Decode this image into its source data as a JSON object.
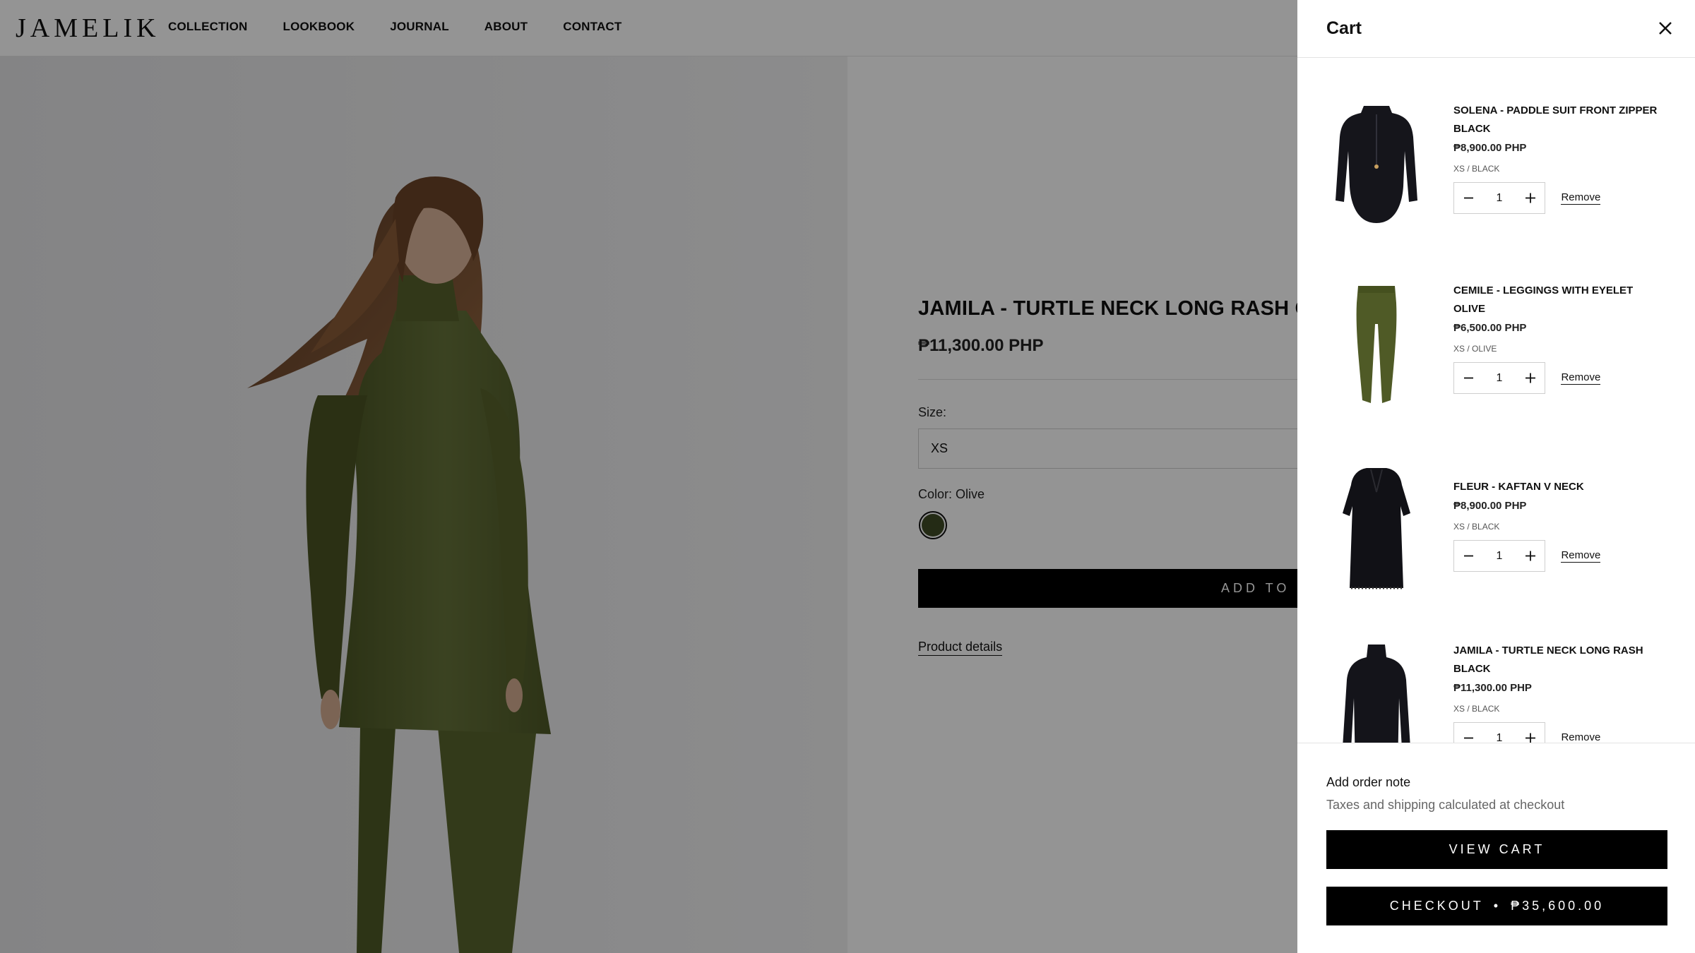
{
  "brand": {
    "logo": "JAMELIK"
  },
  "nav": {
    "items": [
      "COLLECTION",
      "LOOKBOOK",
      "JOURNAL",
      "ABOUT",
      "CONTACT"
    ]
  },
  "product": {
    "title": "JAMILA - TURTLE NECK LONG RASH OLIVE",
    "price": "₱11,300.00 PHP",
    "size_label": "Size:",
    "size_value": "XS",
    "color_label": "Color: Olive",
    "color_swatch": "#3f4a25",
    "add_to_cart": "ADD TO CART",
    "details_link": "Product details"
  },
  "cart": {
    "title": "Cart",
    "items": [
      {
        "title": "SOLENA - PADDLE SUIT FRONT ZIPPER BLACK",
        "price": "₱8,900.00 PHP",
        "variant": "XS / BLACK",
        "qty": "1",
        "remove": "Remove",
        "image": "black-paddle-suit"
      },
      {
        "title": "CEMILE - LEGGINGS WITH EYELET OLIVE",
        "price": "₱6,500.00 PHP",
        "variant": "XS / OLIVE",
        "qty": "1",
        "remove": "Remove",
        "image": "olive-leggings"
      },
      {
        "title": "FLEUR - KAFTAN V NECK",
        "price": "₱8,900.00 PHP",
        "variant": "XS / BLACK",
        "qty": "1",
        "remove": "Remove",
        "image": "black-kaftan"
      },
      {
        "title": "JAMILA - TURTLE NECK LONG RASH BLACK",
        "price": "₱11,300.00 PHP",
        "variant": "XS / BLACK",
        "qty": "1",
        "remove": "Remove",
        "image": "black-rash-top"
      }
    ],
    "order_note": "Add order note",
    "tax_note": "Taxes and shipping calculated at checkout",
    "view_cart": "VIEW CART",
    "checkout_label": "CHECKOUT",
    "checkout_separator": "•",
    "checkout_total": "₱35,600.00"
  },
  "colors": {
    "olive": "#5a6530",
    "black": "#111111",
    "overlay": "rgba(0,0,0,0.42)"
  }
}
